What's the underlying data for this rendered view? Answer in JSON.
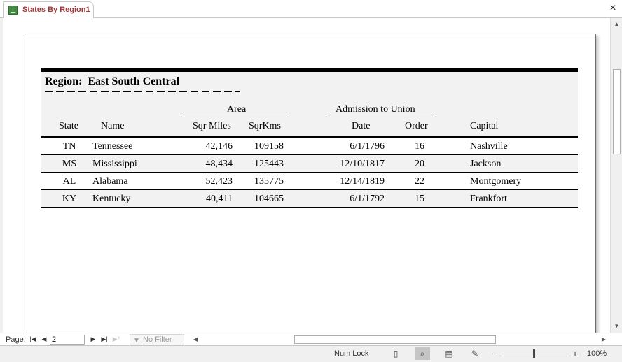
{
  "tab": {
    "title": "States By Region1",
    "icon": "report-icon"
  },
  "report": {
    "region_label": "Region:",
    "region_value": "East South Central",
    "column_groups": {
      "area": "Area",
      "admission": "Admission to Union"
    },
    "columns": {
      "state": "State",
      "name": "Name",
      "sqmiles": "Sqr Miles",
      "sqkms": "SqrKms",
      "date": "Date",
      "order": "Order",
      "capital": "Capital"
    },
    "rows": [
      {
        "state": "TN",
        "name": "Tennessee",
        "sqmiles": "42,146",
        "sqkms": "109158",
        "date": "6/1/1796",
        "order": "16",
        "capital": "Nashville"
      },
      {
        "state": "MS",
        "name": "Mississippi",
        "sqmiles": "48,434",
        "sqkms": "125443",
        "date": "12/10/1817",
        "order": "20",
        "capital": "Jackson"
      },
      {
        "state": "AL",
        "name": "Alabama",
        "sqmiles": "52,423",
        "sqkms": "135775",
        "date": "12/14/1819",
        "order": "22",
        "capital": "Montgomery"
      },
      {
        "state": "KY",
        "name": "Kentucky",
        "sqmiles": "40,411",
        "sqkms": "104665",
        "date": "6/1/1792",
        "order": "15",
        "capital": "Frankfort"
      }
    ]
  },
  "nav": {
    "page_label": "Page:",
    "page_value": "2",
    "filter_label": "No Filter"
  },
  "status": {
    "num_lock": "Num Lock",
    "zoom": "100%"
  }
}
